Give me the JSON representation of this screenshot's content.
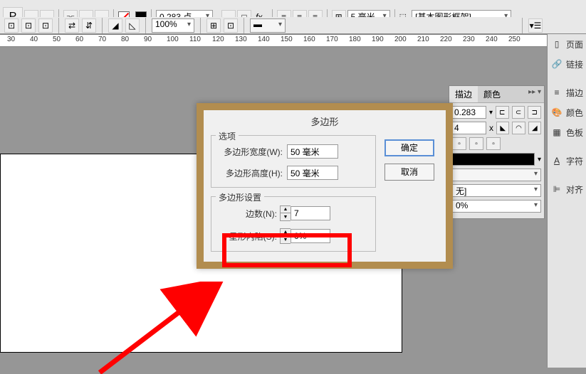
{
  "toolbar": {
    "stroke_value": "0.283 点",
    "zoom_value": "100%",
    "size_value": "5 毫米",
    "frame_dropdown": "[基本图形框架]"
  },
  "ruler": {
    "ticks": [
      30,
      40,
      50,
      60,
      70,
      80,
      90,
      100,
      110,
      120,
      130,
      140,
      150,
      160,
      170,
      180,
      190,
      200,
      210,
      220,
      230,
      240,
      250
    ]
  },
  "right_panel": {
    "items": [
      {
        "icon": "pages-icon",
        "label": "页面"
      },
      {
        "icon": "link-icon",
        "label": "链接"
      },
      {
        "icon": "stroke-icon",
        "label": "描边"
      },
      {
        "icon": "color-icon",
        "label": "颜色"
      },
      {
        "icon": "swatches-icon",
        "label": "色板"
      },
      {
        "icon": "char-icon",
        "label": "字符"
      },
      {
        "icon": "align-icon",
        "label": "对齐"
      }
    ]
  },
  "props_panel": {
    "tabs": [
      "描边",
      "颜色"
    ],
    "active_tab": 0,
    "stroke_width": "0.283",
    "miter_value": "4",
    "x_label": "x",
    "style_label": "无]",
    "gap_label": "0%"
  },
  "dialog": {
    "title": "多边形",
    "group1_label": "选项",
    "group2_label": "多边形设置",
    "width_label": "多边形宽度(W):",
    "width_value": "50 毫米",
    "height_label": "多边形高度(H):",
    "height_value": "50 毫米",
    "sides_label": "边数(N):",
    "sides_value": "7",
    "inset_label": "星形内陷(S):",
    "inset_value": "0%",
    "ok_label": "确定",
    "cancel_label": "取消"
  }
}
